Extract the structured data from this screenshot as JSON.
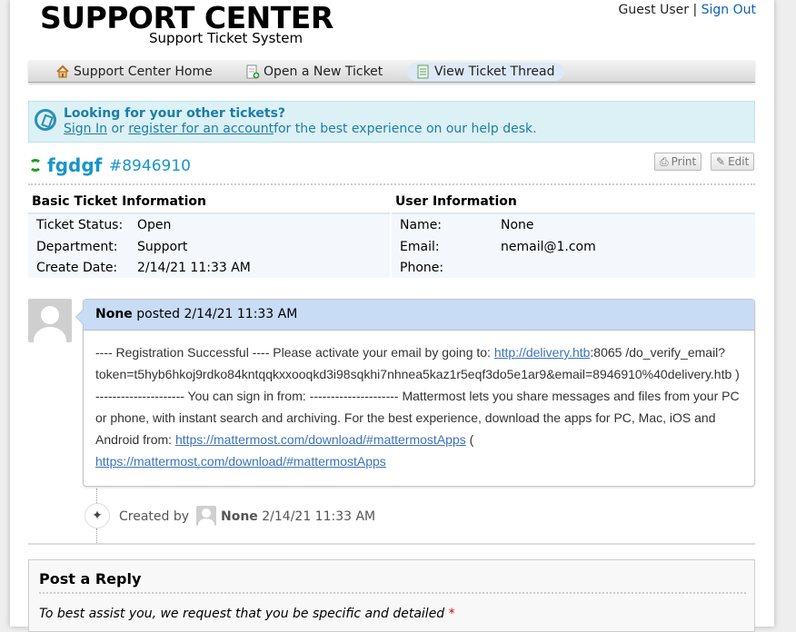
{
  "header": {
    "logo_main": "SUPPORT CENTER",
    "logo_sub": "Support Ticket System",
    "user_label": "Guest User",
    "separator": "|",
    "sign_out": "Sign Out"
  },
  "nav": {
    "items": [
      {
        "label": "Support Center Home",
        "icon": "home-icon"
      },
      {
        "label": "Open a New Ticket",
        "icon": "new-ticket-icon"
      },
      {
        "label": "View Ticket Thread",
        "icon": "ticket-thread-icon",
        "active": true
      }
    ]
  },
  "notice": {
    "title": "Looking for your other tickets?",
    "sign_in": "Sign In",
    "or": "or",
    "register": "register for an account",
    "suffix": "for the best experience on our help desk."
  },
  "ticket": {
    "subject": "fgdgf",
    "number": "#8946910",
    "print_label": "Print",
    "edit_label": "Edit"
  },
  "basic_info": {
    "heading": "Basic Ticket Information",
    "rows": [
      {
        "key": "Ticket Status:",
        "value": "Open"
      },
      {
        "key": "Department:",
        "value": "Support"
      },
      {
        "key": "Create Date:",
        "value": "2/14/21 11:33 AM"
      }
    ]
  },
  "user_info": {
    "heading": "User Information",
    "rows": [
      {
        "key": "Name:",
        "value": "None"
      },
      {
        "key": "Email:",
        "value": "nemail@1.com"
      },
      {
        "key": "Phone:",
        "value": ""
      }
    ]
  },
  "thread": {
    "author": "None",
    "posted": "posted",
    "date": "2/14/21 11:33 AM",
    "body_1": "---- Registration Successful ---- Please activate your email by going to: ",
    "link_1": "http://delivery.htb",
    "body_2": ":8065 /do_verify_email?token=t5hyb6hkoj9rdko84kntqqkxxooqkd3i98sqkhi7nhnea5kaz1r5eqf3do5e1ar9&email=8946910%40delivery.htb ) --------------------- You can sign in from: --------------------- Mattermost lets you share messages and files from your PC or phone, with instant search and archiving. For the best experience, download the apps for PC, Mac, iOS and Android from: ",
    "link_2": "https://mattermost.com/download/#mattermostApps",
    "body_3": " ( ",
    "link_3": "https://mattermost.com/download/#mattermostApps"
  },
  "event": {
    "created_by": "Created by",
    "name": "None",
    "date": "2/14/21 11:33 AM"
  },
  "reply": {
    "title": "Post a Reply",
    "instructions": "To best assist you, we request that you be specific and detailed",
    "required_mark": "*"
  },
  "colors": {
    "accent": "#1895c9",
    "notice_bg": "#dcf1f6",
    "thread_head_bg": "#c8dcf5",
    "info_bg": "#f4f8fc"
  }
}
